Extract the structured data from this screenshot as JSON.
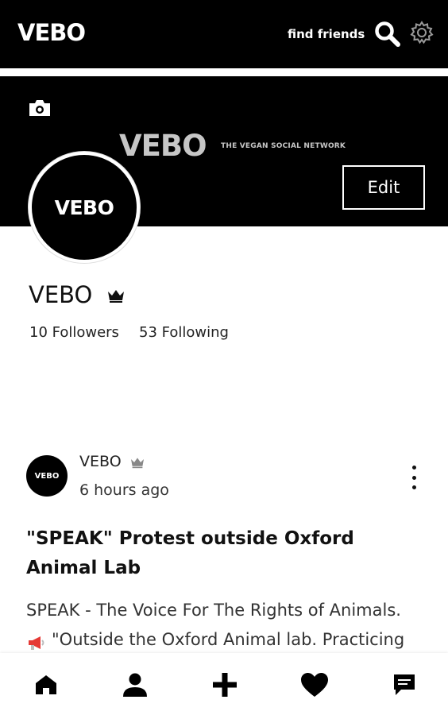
{
  "app": {
    "logo": "VEBO",
    "find_friends": "find friends"
  },
  "cover": {
    "brand": "VEBO",
    "tagline": "THE VEGAN SOCIAL NETWORK",
    "edit_label": "Edit"
  },
  "profile": {
    "avatar_text": "VEBO",
    "name": "VEBO",
    "followers": "10 Followers",
    "following": "53 Following"
  },
  "post": {
    "avatar_text": "VEBO",
    "author": "VEBO",
    "time": "6 hours ago",
    "title": "\"SPEAK\" Protest outside Oxford Animal Lab",
    "body_line1": "SPEAK - The Voice For The Rights of Animals.",
    "body_line2": "\"Outside the Oxford Animal lab. Practicing"
  },
  "icons": {
    "search": "search-icon",
    "settings": "gear-icon",
    "camera": "camera-icon",
    "crown": "crown-icon",
    "more": "more-vertical-icon",
    "megaphone": "megaphone-icon",
    "home": "home-icon",
    "profile": "person-icon",
    "add": "plus-icon",
    "favorites": "heart-icon",
    "messages": "chat-icon"
  },
  "colors": {
    "bar": "#000000",
    "cover_brand": "#c6c6c6",
    "megaphone": "#e53935"
  }
}
